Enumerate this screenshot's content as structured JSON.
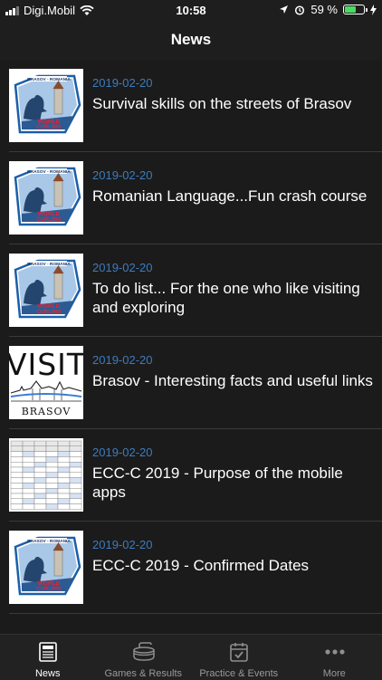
{
  "status_bar": {
    "carrier": "Digi.Mobil",
    "time": "10:58",
    "battery_percent": "59 %",
    "battery_level": 0.59
  },
  "header": {
    "title": "News"
  },
  "news": [
    {
      "date": "2019-02-20",
      "title": "Survival skills on the streets of Brasov",
      "thumb": "logo"
    },
    {
      "date": "2019-02-20",
      "title": "Romanian Language...Fun crash course",
      "thumb": "logo"
    },
    {
      "date": "2019-02-20",
      "title": "To do list... For the one who like visiting and exploring",
      "thumb": "logo"
    },
    {
      "date": "2019-02-20",
      "title": "Brasov - Interesting facts and useful links",
      "thumb": "visit"
    },
    {
      "date": "2019-02-20",
      "title": "ECC-C 2019 - Purpose of the mobile apps",
      "thumb": "table"
    },
    {
      "date": "2019-02-20",
      "title": "ECC-C 2019 - Confirmed Dates",
      "thumb": "logo"
    }
  ],
  "thumb_text": {
    "logo_top": "BRASOV - ROMANIA",
    "logo_world": "WORLD",
    "logo_curling": "CURLING",
    "visit_word": "VISIT",
    "visit_city": "BRASOV"
  },
  "tabs": [
    {
      "label": "News",
      "icon": "newspaper-icon",
      "active": true
    },
    {
      "label": "Games & Results",
      "icon": "curling-stone-icon",
      "active": false
    },
    {
      "label": "Practice & Events",
      "icon": "calendar-check-icon",
      "active": false
    },
    {
      "label": "More",
      "icon": "more-dots-icon",
      "active": false
    }
  ],
  "colors": {
    "date": "#3d7bbd",
    "background": "#1e1e1e",
    "battery": "#4cd964"
  }
}
